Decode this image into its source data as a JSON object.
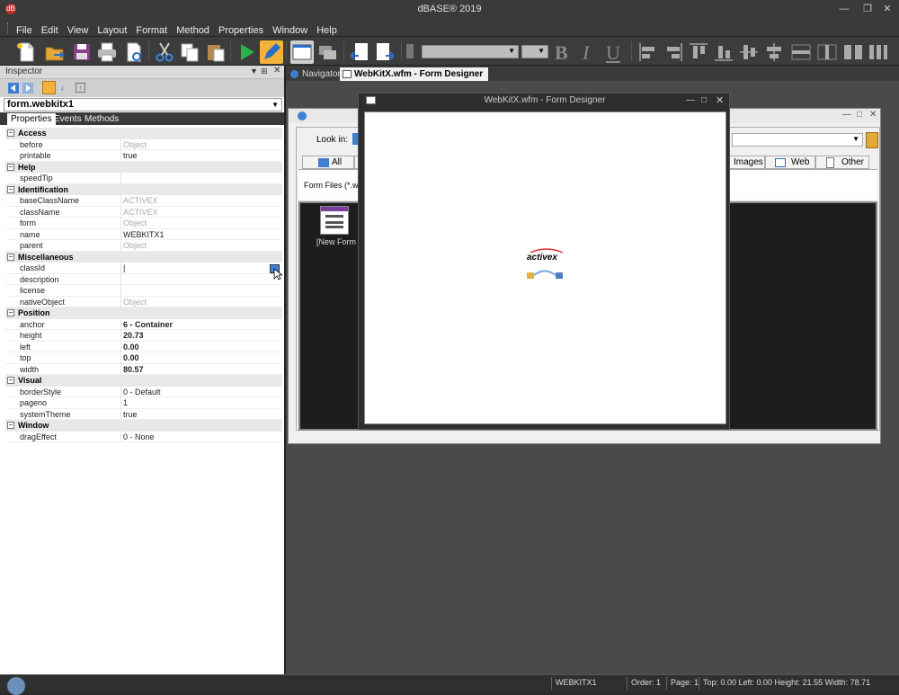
{
  "window": {
    "title": "dBASE® 2019",
    "app_icon_label": "dB"
  },
  "menu": [
    "File",
    "Edit",
    "View",
    "Layout",
    "Format",
    "Method",
    "Properties",
    "Window",
    "Help"
  ],
  "inspector": {
    "title": "Inspector",
    "object": "form.webkitx1",
    "tabs": [
      "Properties",
      "Events",
      "Methods"
    ],
    "groups": [
      {
        "name": "Access",
        "props": [
          {
            "n": "before",
            "v": "Object",
            "s": "dim"
          },
          {
            "n": "printable",
            "v": "true",
            "s": ""
          }
        ]
      },
      {
        "name": "Help",
        "props": [
          {
            "n": "speedTip",
            "v": "",
            "s": ""
          }
        ]
      },
      {
        "name": "Identification",
        "props": [
          {
            "n": "baseClassName",
            "v": "ACTIVEX",
            "s": "dim"
          },
          {
            "n": "className",
            "v": "ACTIVEX",
            "s": "dim"
          },
          {
            "n": "form",
            "v": "Object",
            "s": "dim"
          },
          {
            "n": "name",
            "v": "WEBKITX1",
            "s": ""
          },
          {
            "n": "parent",
            "v": "Object",
            "s": "dim"
          }
        ]
      },
      {
        "name": "Miscellaneous",
        "props": [
          {
            "n": "classId",
            "v": "|",
            "s": ""
          },
          {
            "n": "description",
            "v": "",
            "s": ""
          },
          {
            "n": "license",
            "v": "",
            "s": ""
          },
          {
            "n": "nativeObject",
            "v": "Object",
            "s": "dim"
          }
        ]
      },
      {
        "name": "Position",
        "props": [
          {
            "n": "anchor",
            "v": "6 - Container",
            "s": "bold"
          },
          {
            "n": "height",
            "v": "20.73",
            "s": "bold"
          },
          {
            "n": "left",
            "v": "0.00",
            "s": "bold"
          },
          {
            "n": "top",
            "v": "0.00",
            "s": "bold"
          },
          {
            "n": "width",
            "v": "80.57",
            "s": "bold"
          }
        ]
      },
      {
        "name": "Visual",
        "props": [
          {
            "n": "borderStyle",
            "v": "0 - Default",
            "s": ""
          },
          {
            "n": "pageno",
            "v": "1",
            "s": ""
          },
          {
            "n": "systemTheme",
            "v": "true",
            "s": ""
          }
        ]
      },
      {
        "name": "Window",
        "props": [
          {
            "n": "dragEffect",
            "v": "0 - None",
            "s": ""
          }
        ]
      }
    ]
  },
  "doc_tabs": {
    "navigator": "Navigator",
    "designer": "WebKitX.wfm - Form Designer"
  },
  "navigator": {
    "look_in_label": "Look in:",
    "cat_all": "All",
    "cat_images": "Images",
    "cat_web": "Web",
    "cat_other": "Other",
    "filter_label": "Form Files (*.wfm",
    "new_form_label": "[New Form"
  },
  "form_designer": {
    "title": "WebKitX.wfm - Form Designer",
    "activex_label": "activex"
  },
  "status": {
    "object": "WEBKITX1",
    "order": "Order: 1",
    "page": "Page: 1",
    "geometry": "Top: 0.00 Left: 0.00 Height: 21.55 Width: 78.71"
  }
}
